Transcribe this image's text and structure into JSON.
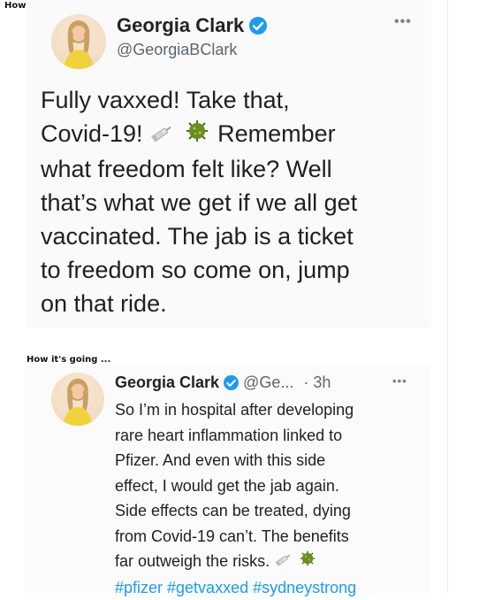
{
  "top_caption": "How it started ...",
  "bottom_caption": "How it's going ...",
  "tweet1": {
    "author_name": "Georgia Clark",
    "handle": "@GeorgiaBClark",
    "more_icon": "ellipsis-icon",
    "lines": [
      "Fully vaxxed! Take that,",
      "Covid-19!",
      "Remember",
      "what freedom felt like? Well",
      "that’s what we get if we all get",
      "vaccinated. The jab is a ticket",
      "to freedom so come on, jump",
      "on that ride."
    ]
  },
  "tweet2": {
    "author_name": "Georgia Clark",
    "handle": "@Ge...",
    "time": "· 3h",
    "lines": [
      "So I’m in hospital after developing",
      "rare heart inflammation linked to",
      "Pfizer. And even with this side",
      "effect, I would get the jab again.",
      "Side effects can be treated, dying",
      "from Covid-19 can’t. The benefits",
      "far outweigh the risks."
    ],
    "hashtags": "#pfizer #getvaxxed #sydneystrong"
  },
  "colors": {
    "verified": "#1d9bf0",
    "hashtag": "#1d9bf0",
    "handle": "#5b6670",
    "virus_green": "#6a8f1f"
  }
}
